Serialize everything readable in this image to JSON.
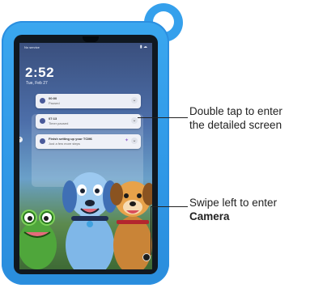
{
  "status_bar": {
    "carrier": "No service",
    "icons": "▮ ☁"
  },
  "lock_screen": {
    "time": "2:52",
    "date": "Tue, Feb 27"
  },
  "notifications": [
    {
      "title": "00:00",
      "subtitle": "Paused"
    },
    {
      "title": "07:13",
      "subtitle": "Timer paused"
    },
    {
      "title": "Finish setting up your TCM6",
      "subtitle": "Just a few more steps"
    }
  ],
  "callouts": {
    "double_tap_line1": "Double tap to enter",
    "double_tap_line2": "the detailed screen",
    "swipe_line1": "Swipe left to enter",
    "swipe_line2": "Camera"
  },
  "colors": {
    "case": "#35a0ec",
    "bezel": "#101820",
    "notification_bg": "#f5f6fa"
  }
}
